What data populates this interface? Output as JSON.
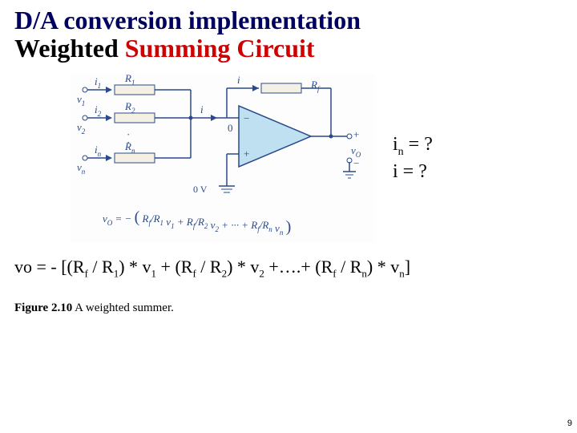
{
  "title": {
    "line1": "D/A conversion implementation",
    "line2_black": "Weighted ",
    "line2_red": "Summing Circuit"
  },
  "figure": {
    "inputs": {
      "i1": "i",
      "i1_sub": "1",
      "v1": "v",
      "v1_sub": "1",
      "R1": "R",
      "R1_sub": "1",
      "i2": "i",
      "i2_sub": "2",
      "v2": "v",
      "v2_sub": "2",
      "R2": "R",
      "R2_sub": "2",
      "in": "i",
      "in_sub": "n",
      "vn": "v",
      "vn_sub": "n",
      "Rn": "R",
      "Rn_sub": "n"
    },
    "i_label": "i",
    "Rf": "R",
    "Rf_sub": "f",
    "zero": "0",
    "zeroV": "0 V",
    "vO": "v",
    "vO_sub": "O",
    "result_eq": {
      "pre": "v",
      "pre_sub": "O",
      "eq": " = −",
      "open": "(",
      "t1a": "R",
      "t1a_sub": "f",
      "slash": "⁄",
      "t1b": "R",
      "t1b_sub": "1",
      "v1": "v",
      "v1_sub": "1",
      "plus": " + ",
      "t2a": "R",
      "t2a_sub": "f",
      "t2b": "R",
      "t2b_sub": "2",
      "v2": "v",
      "v2_sub": "2",
      "dots": " + ··· + ",
      "tna": "R",
      "tna_sub": "f",
      "tnb": "R",
      "tnb_sub": "n",
      "vn": "v",
      "vn_sub": "n",
      "close": ")"
    }
  },
  "questions": {
    "q1_a": "i",
    "q1_sub": "n",
    "q1_b": " = ?",
    "q2_a": "i",
    "q2_b": "  = ?"
  },
  "vo_equation": {
    "lhs": "vo = - [(R",
    "f1": "f",
    "r1a": " / R",
    "r1b": "1",
    "v1a": ") * v",
    "v1b": "1",
    "plus1": " + (R",
    "f2": "f",
    "r2a": " / R",
    "r2b": "2",
    "v2a": ") * v",
    "v2b": "2",
    "dots": " +….+ (R",
    "fn": "f",
    "rna": " / R",
    "rnb": "n",
    "vna": ") * v",
    "vnb": "n",
    "close": "]"
  },
  "caption": {
    "bold": "Figure 2.10",
    "rest": "  A weighted summer."
  },
  "page": "9"
}
